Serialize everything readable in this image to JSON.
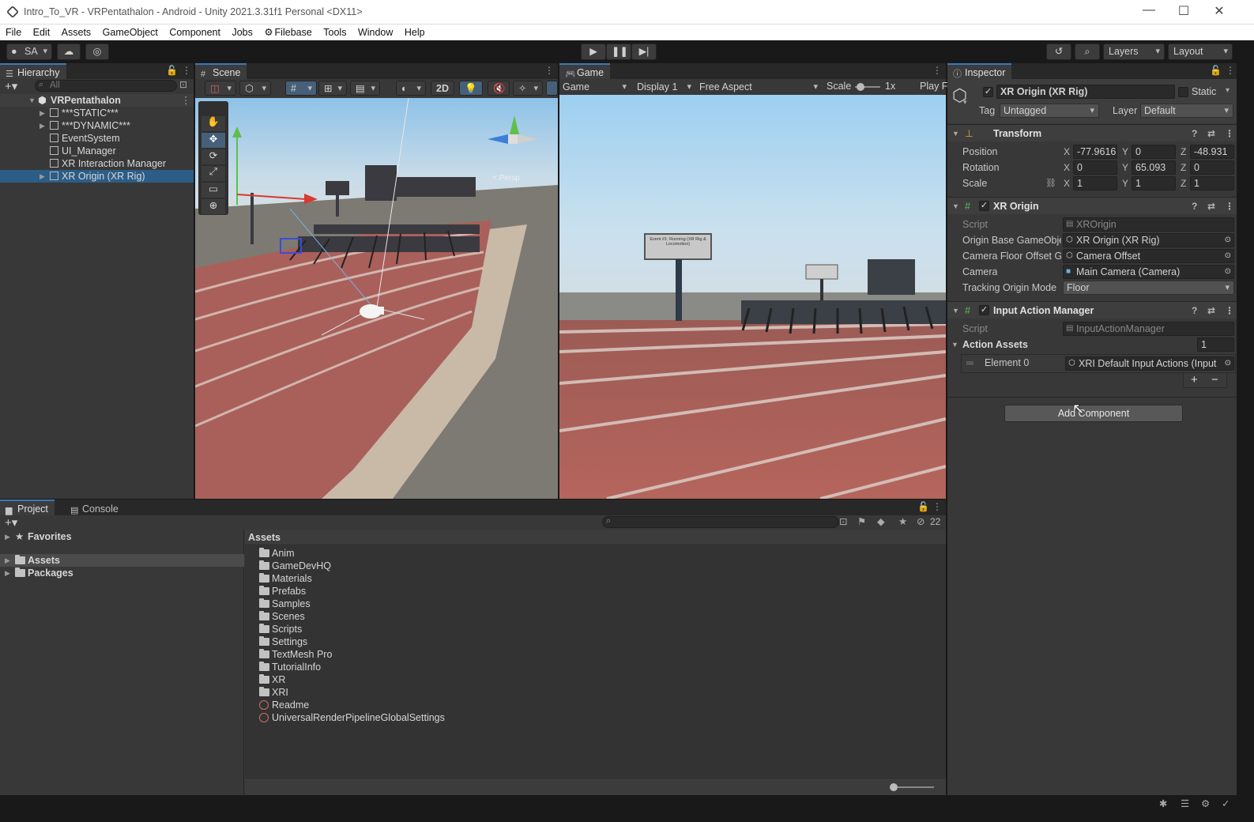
{
  "window": {
    "title": "Intro_To_VR - VRPentathalon - Android - Unity 2021.3.31f1 Personal <DX11>",
    "controls": [
      "—",
      "☐",
      "✕"
    ]
  },
  "menu": [
    "File",
    "Edit",
    "Assets",
    "GameObject",
    "Component",
    "Jobs",
    "Filebase",
    "Tools",
    "Window",
    "Help"
  ],
  "toolbar": {
    "account": "SA",
    "layers": "Layers",
    "layout": "Layout"
  },
  "hierarchy": {
    "tab": "Hierarchy",
    "search_placeholder": "All",
    "scene": "VRPentathalon",
    "items": [
      "***STATIC***",
      "***DYNAMIC***",
      "EventSystem",
      "UI_Manager",
      "XR Interaction Manager",
      "XR Origin (XR Rig)"
    ]
  },
  "scene": {
    "tab": "Scene",
    "two_d": "2D",
    "persp": "< Persp"
  },
  "game": {
    "tab": "Game",
    "mode": "Game",
    "display": "Display 1",
    "aspect": "Free Aspect",
    "scale_label": "Scale",
    "scale_value": "1x",
    "play": "Play F",
    "billboard": "Event #1: Running (XR Rig & Locomotion)"
  },
  "inspector": {
    "tab": "Inspector",
    "object_name": "XR Origin (XR Rig)",
    "static_label": "Static",
    "tag_label": "Tag",
    "tag_value": "Untagged",
    "layer_label": "Layer",
    "layer_value": "Default",
    "transform": {
      "title": "Transform",
      "position_label": "Position",
      "rotation_label": "Rotation",
      "scale_label": "Scale",
      "position": {
        "x": "-77.9616",
        "y": "0",
        "z": "-48.931"
      },
      "rotation": {
        "x": "0",
        "y": "65.093",
        "z": "0"
      },
      "scale": {
        "x": "1",
        "y": "1",
        "z": "1"
      }
    },
    "xr_origin": {
      "title": "XR Origin",
      "script_label": "Script",
      "script_value": "XROrigin",
      "origin_label": "Origin Base GameObje",
      "origin_value": "XR Origin (XR Rig)",
      "floor_label": "Camera Floor Offset Ga",
      "floor_value": "Camera Offset",
      "camera_label": "Camera",
      "camera_value": "Main Camera (Camera)",
      "tracking_label": "Tracking Origin Mode",
      "tracking_value": "Floor"
    },
    "input_action": {
      "title": "Input Action Manager",
      "script_label": "Script",
      "script_value": "InputActionManager",
      "assets_label": "Action Assets",
      "assets_count": "1",
      "element_label": "Element 0",
      "element_value": "XRI Default Input Actions (Input"
    },
    "add_component": "Add Component"
  },
  "project": {
    "tab_project": "Project",
    "tab_console": "Console",
    "hidden_count": "22",
    "tree": [
      "Favorites",
      "Assets",
      "Packages"
    ],
    "breadcrumb": "Assets",
    "folders": [
      "Anim",
      "GameDevHQ",
      "Materials",
      "Prefabs",
      "Samples",
      "Scenes",
      "Scripts",
      "Settings",
      "TextMesh Pro",
      "TutorialInfo",
      "XR",
      "XRI"
    ],
    "assets": [
      "Readme",
      "UniversalRenderPipelineGlobalSettings"
    ]
  }
}
